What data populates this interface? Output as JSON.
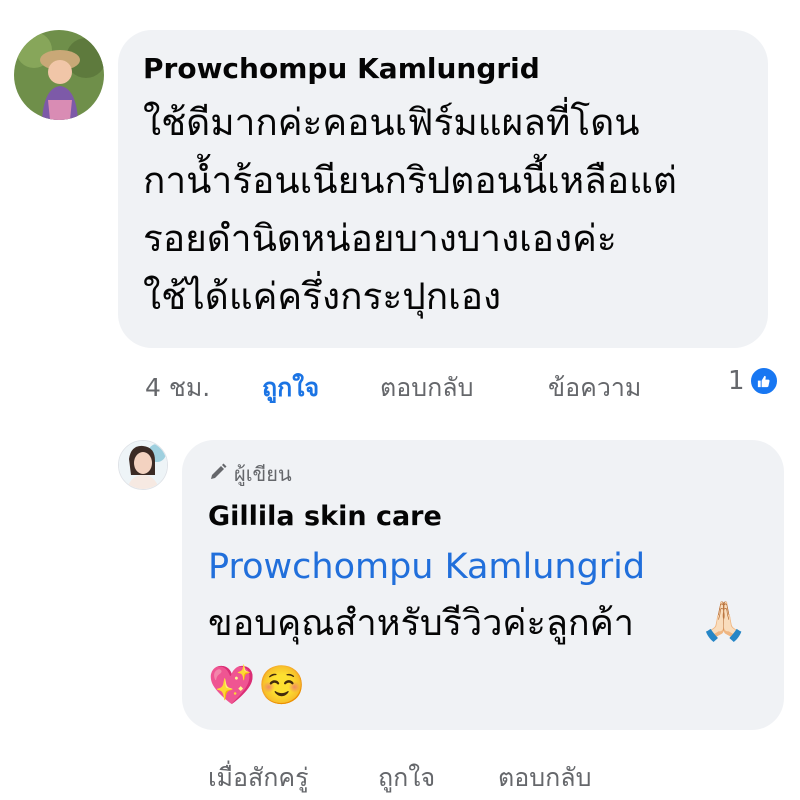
{
  "comment": {
    "author": "Prowchompu Kamlungrid",
    "lines": [
      "ใช้ดีมากค่ะคอนเฟิร์มแผลที่โดน",
      "กาน้ำร้อนเนียนกริปตอนนี้เหลือแต่",
      "รอยดำนิดหน่อยบางบางเองค่ะ",
      "ใช้ได้แค่ครึ่งกระปุกเอง"
    ],
    "time": "4 ชม.",
    "like_label": "ถูกใจ",
    "reply_label": "ตอบกลับ",
    "message_label": "ข้อความ",
    "reaction_count": "1"
  },
  "reply": {
    "author_tag": "ผู้เขียน",
    "author": "Gillila skin care",
    "mention": "Prowchompu Kamlungrid",
    "text": "ขอบคุณสำหรับรีวิวค่ะลูกค้า",
    "emojis": [
      "🙏🏻",
      "💖",
      "☺️"
    ],
    "time": "เมื่อสักครู่",
    "like_label": "ถูกใจ",
    "reply_label": "ตอบกลับ"
  },
  "colors": {
    "bubble": "#f0f2f5",
    "link": "#216fdb",
    "like_active": "#1b74e4",
    "meta": "#65676b",
    "reaction_badge": "#1877f2"
  },
  "icons": {
    "author_tag_icon": "pencil-icon",
    "reaction_icon": "thumbs-up-icon"
  }
}
